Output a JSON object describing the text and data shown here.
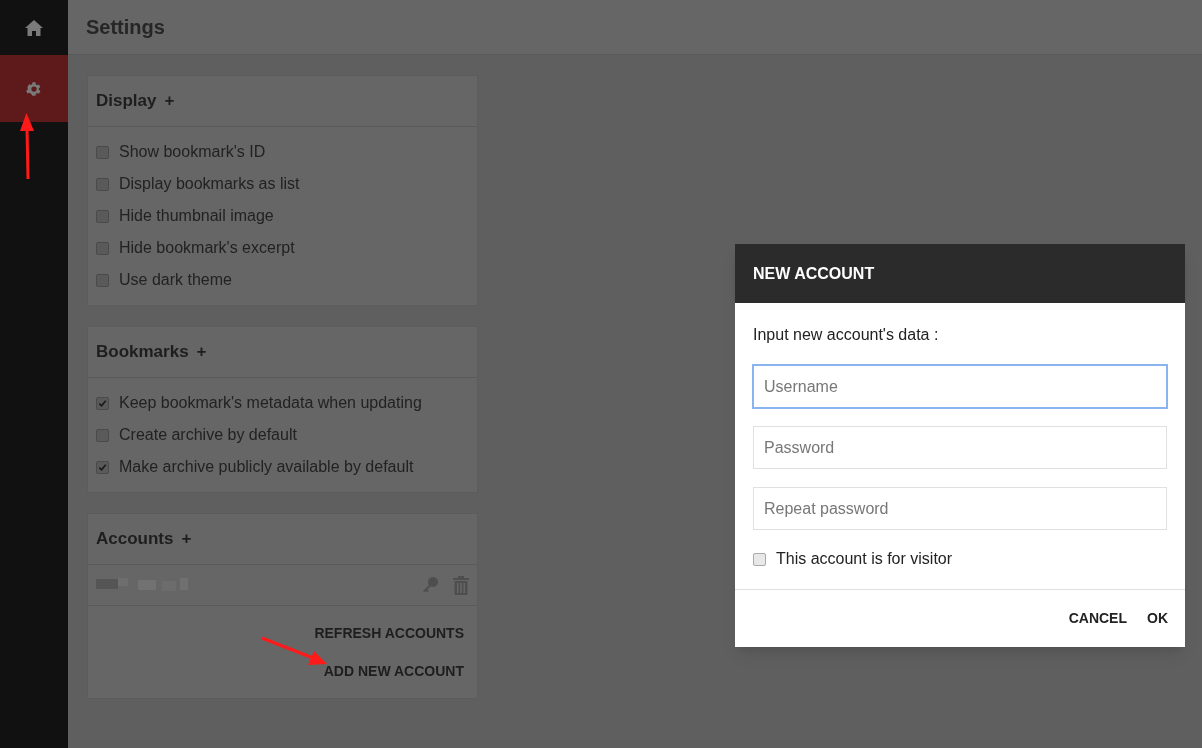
{
  "sidebar": {
    "items": [
      {
        "kind": "home",
        "selected": false
      },
      {
        "kind": "settings",
        "selected": true
      }
    ]
  },
  "header": {
    "title": "Settings"
  },
  "sections": [
    {
      "title": "Display",
      "expander": "+",
      "options": [
        {
          "label": "Show bookmark's ID",
          "checked": false
        },
        {
          "label": "Display bookmarks as list",
          "checked": false
        },
        {
          "label": "Hide thumbnail image",
          "checked": false
        },
        {
          "label": "Hide bookmark's excerpt",
          "checked": false
        },
        {
          "label": "Use dark theme",
          "checked": false
        }
      ]
    },
    {
      "title": "Bookmarks",
      "expander": "+",
      "options": [
        {
          "label": "Keep bookmark's metadata when updating",
          "checked": true
        },
        {
          "label": "Create archive by default",
          "checked": false
        },
        {
          "label": "Make archive publicly available by default",
          "checked": true
        }
      ]
    }
  ],
  "accounts": {
    "title": "Accounts",
    "expander": "+",
    "buttons": [
      "REFRESH ACCOUNTS",
      "ADD NEW ACCOUNT"
    ]
  },
  "dialog": {
    "title": "NEW ACCOUNT",
    "prompt": "Input new account's data :",
    "fields": [
      {
        "placeholder": "Username",
        "focused": true
      },
      {
        "placeholder": "Password",
        "focused": false
      },
      {
        "placeholder": "Repeat password",
        "focused": false
      }
    ],
    "visitor": {
      "label": "This account is for visitor",
      "checked": false
    },
    "buttons": [
      "CANCEL",
      "OK"
    ]
  }
}
